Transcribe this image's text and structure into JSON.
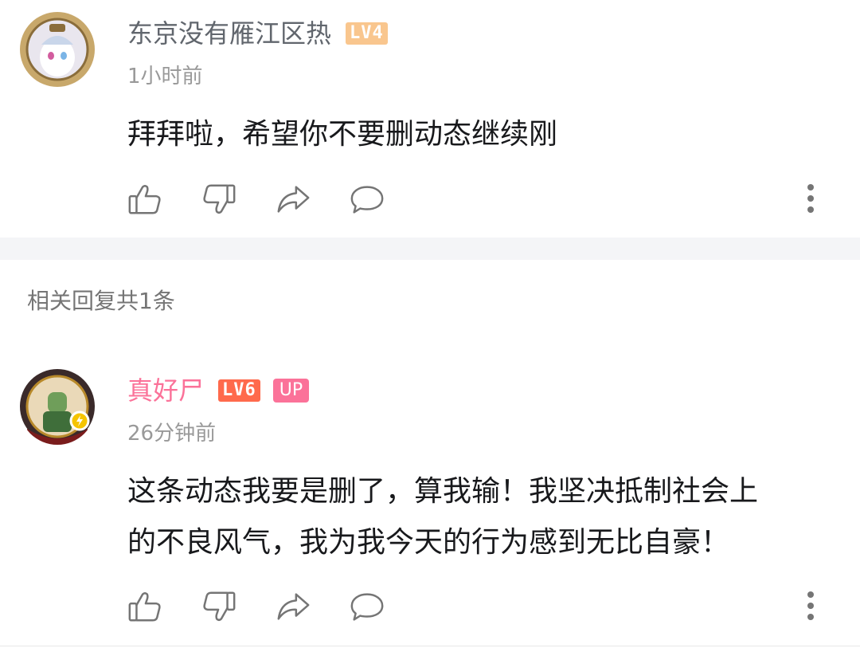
{
  "comment": {
    "username": "东京没有雁江区热",
    "level": "LV4",
    "time": "1小时前",
    "text": "拜拜啦，希望你不要删动态继续刚",
    "username_color": "#61666d",
    "level_color": "#f9c68e"
  },
  "replies_header": "相关回复共1条",
  "reply": {
    "username": "真好尸",
    "level": "LV6",
    "up_badge": "UP",
    "time": "26分钟前",
    "text_line1": "这条动态我要是删了，算我输！我坚决抵制社会上",
    "text_line2": "的不良风气，我为我今天的行为感到无比自豪！",
    "username_color": "#fb7299",
    "level_color": "#ff6a4c"
  },
  "icons": {
    "like": "thumbs-up-icon",
    "dislike": "thumbs-down-icon",
    "share": "share-arrow-icon",
    "reply": "comment-bubble-icon",
    "more": "more-vertical-icon"
  }
}
